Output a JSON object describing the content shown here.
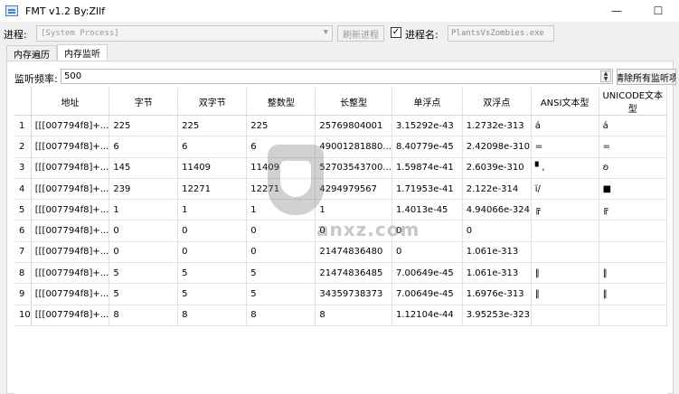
{
  "window": {
    "title": "FMT v1.2 By:Zllf",
    "minimize_glyph": "—",
    "maximize_glyph": "☐"
  },
  "toolbar": {
    "process_label": "进程:",
    "process_value": "[System Process]",
    "refresh_label": "刷新进程",
    "process_name_checked": true,
    "process_name_label": "进程名:",
    "process_name_value": "PlantsVsZombies.exe"
  },
  "tabs": [
    {
      "label": "内存遍历",
      "active": false
    },
    {
      "label": "内存监听",
      "active": true
    }
  ],
  "monitor": {
    "frequency_label": "监听频率:",
    "frequency_value": "500",
    "clear_label": "清除所有监听项"
  },
  "table": {
    "columns": [
      "地址",
      "字节",
      "双字节",
      "整数型",
      "长整型",
      "单浮点",
      "双浮点",
      "ANSI文本型",
      "UNICODE文本型"
    ],
    "rows": [
      {
        "n": "1",
        "cells": [
          "[[[007794f8]+...",
          "225",
          "225",
          "225",
          "25769804001",
          "3.15292e-43",
          "1.2732e-313",
          "á",
          "á"
        ]
      },
      {
        "n": "2",
        "cells": [
          "[[[007794f8]+...",
          "6",
          "6",
          "6",
          "49001281880...",
          "8.40779e-45",
          "2.42098e-310",
          "=",
          "="
        ]
      },
      {
        "n": "3",
        "cells": [
          "[[[007794f8]+...",
          "145",
          "11409",
          "11409",
          "52703543700...",
          "1.59874e-41",
          "2.6039e-310",
          "▘,",
          "ʚ"
        ]
      },
      {
        "n": "4",
        "cells": [
          "[[[007794f8]+...",
          "239",
          "12271",
          "12271",
          "4294979567",
          "1.71953e-41",
          "2.122e-314",
          "ï/",
          "■"
        ]
      },
      {
        "n": "5",
        "cells": [
          "[[[007794f8]+...",
          "1",
          "1",
          "1",
          "1",
          "1.4013e-45",
          "4.94066e-324",
          "╔",
          "╔"
        ]
      },
      {
        "n": "6",
        "cells": [
          "[[[007794f8]+...",
          "0",
          "0",
          "0",
          "0",
          "0",
          "0",
          "",
          ""
        ]
      },
      {
        "n": "7",
        "cells": [
          "[[[007794f8]+...",
          "0",
          "0",
          "0",
          "21474836480",
          "0",
          "1.061e-313",
          "",
          ""
        ]
      },
      {
        "n": "8",
        "cells": [
          "[[[007794f8]+...",
          "5",
          "5",
          "5",
          "21474836485",
          "7.00649e-45",
          "1.061e-313",
          "‖",
          "‖"
        ]
      },
      {
        "n": "9",
        "cells": [
          "[[[007794f8]+...",
          "5",
          "5",
          "5",
          "34359738373",
          "7.00649e-45",
          "1.6976e-313",
          "‖",
          "‖"
        ]
      },
      {
        "n": "10",
        "cells": [
          "[[[007794f8]+...",
          "8",
          "8",
          "8",
          "8",
          "1.12104e-44",
          "3.95253e-323",
          "",
          ""
        ]
      }
    ]
  },
  "watermark": {
    "text": "anxz.com"
  }
}
